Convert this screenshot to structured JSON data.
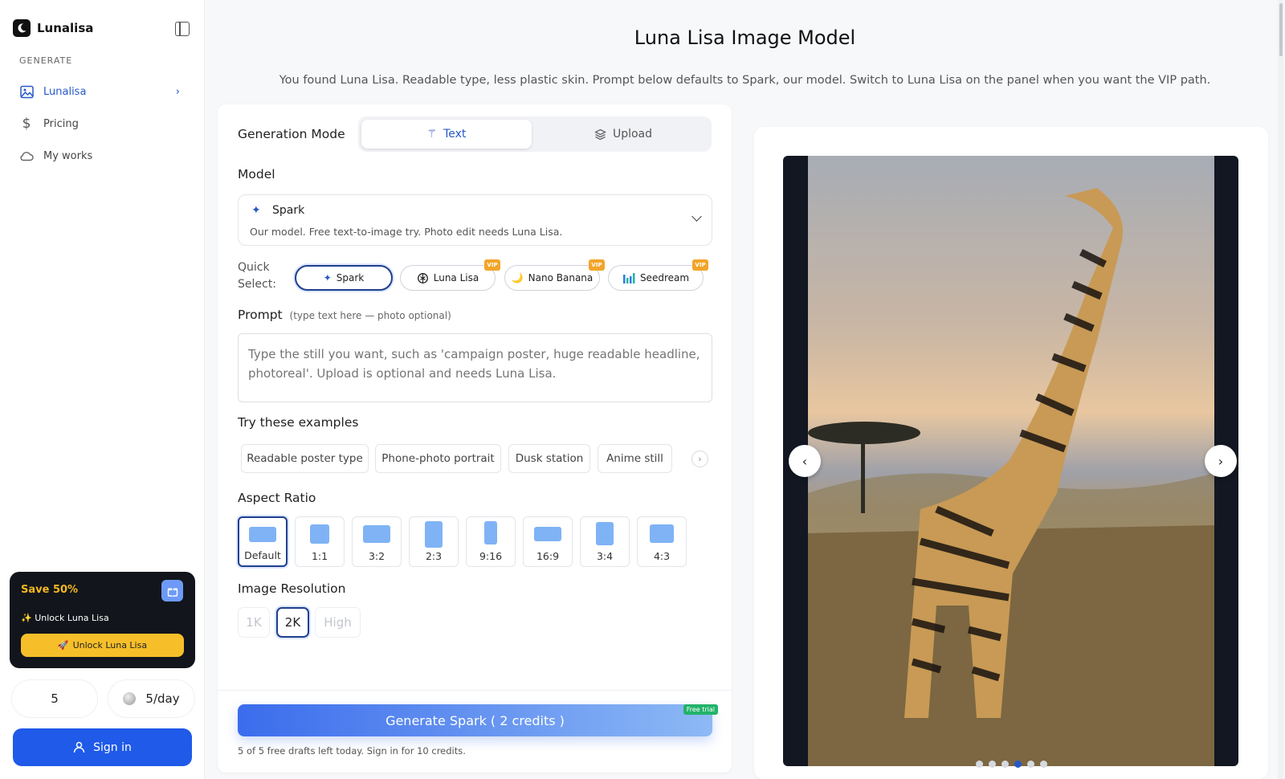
{
  "sidebar": {
    "brand": "Lunalisa",
    "section_label": "GENERATE",
    "items": [
      {
        "label": "Lunalisa",
        "icon": "image-icon",
        "active": true
      },
      {
        "label": "Pricing",
        "icon": "dollar-icon",
        "active": false
      },
      {
        "label": "My works",
        "icon": "cloud-icon",
        "active": false
      }
    ],
    "promo": {
      "title": "Save 50%",
      "subtitle": "Unlock Luna Lisa",
      "button": "Unlock Luna Lisa"
    },
    "credits_value": "5",
    "daily_value": "5/day",
    "signin_label": "Sign in"
  },
  "header": {
    "title": "Luna Lisa Image Model",
    "subtitle": "You found Luna Lisa. Readable type, less plastic skin. Prompt below defaults to Spark, our model. Switch to Luna Lisa on the panel when you want the VIP path."
  },
  "form": {
    "generation_mode_label": "Generation Mode",
    "modes": [
      {
        "label": "Text",
        "selected": true
      },
      {
        "label": "Upload",
        "selected": false
      }
    ],
    "model_label": "Model",
    "model": {
      "name": "Spark",
      "description": "Our model. Free text-to-image try. Photo edit needs Luna Lisa."
    },
    "quick_select_label": "Quick Select:",
    "quick_select": [
      {
        "label": "Spark",
        "vip": false,
        "selected": true
      },
      {
        "label": "Luna Lisa",
        "vip": true,
        "selected": false
      },
      {
        "label": "Nano Banana",
        "vip": true,
        "selected": false
      },
      {
        "label": "Seedream",
        "vip": true,
        "selected": false
      }
    ],
    "vip_badge": "VIP",
    "prompt_label": "Prompt",
    "prompt_hint": "(type text here — photo optional)",
    "prompt_placeholder": "Type the still you want, such as 'campaign poster, huge readable headline, photoreal'. Upload is optional and needs Luna Lisa.",
    "examples_label": "Try these examples",
    "examples": [
      "Readable poster type",
      "Phone-photo portrait",
      "Dusk station",
      "Anime still"
    ],
    "aspect_ratio_label": "Aspect Ratio",
    "aspect_ratios": [
      {
        "label": "Default",
        "selected": true
      },
      {
        "label": "1:1",
        "selected": false
      },
      {
        "label": "3:2",
        "selected": false
      },
      {
        "label": "2:3",
        "selected": false
      },
      {
        "label": "9:16",
        "selected": false
      },
      {
        "label": "16:9",
        "selected": false
      },
      {
        "label": "3:4",
        "selected": false
      },
      {
        "label": "4:3",
        "selected": false
      }
    ],
    "resolution_label": "Image Resolution",
    "resolutions": [
      {
        "label": "1K",
        "selected": false
      },
      {
        "label": "2K",
        "selected": true
      },
      {
        "label": "High",
        "selected": false
      }
    ],
    "generate_button": "Generate Spark ( 2 credits )",
    "free_trial_badge": "Free trial",
    "generate_note": "5 of 5 free drafts left today. Sign in for 10 credits."
  },
  "preview": {
    "slide_count": 6,
    "active_slide": 4
  },
  "colors": {
    "accent": "#2858c8",
    "promo_bg": "#12151b",
    "promo_accent": "#f6bf2a",
    "signin_bg": "#1f5ae8"
  }
}
